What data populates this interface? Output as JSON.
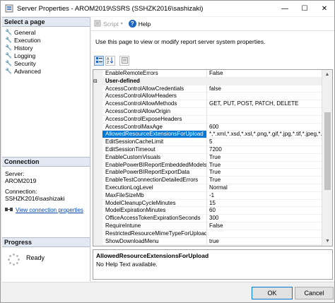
{
  "window": {
    "title": "Server Properties - AROM2019\\SSRS (SSHZK2016\\sashizaki)"
  },
  "left": {
    "select_page_header": "Select a page",
    "pages": [
      "General",
      "Execution",
      "History",
      "Logging",
      "Security",
      "Advanced"
    ],
    "connection_header": "Connection",
    "server_label": "Server:",
    "server_value": "AROM2019",
    "connection_label": "Connection:",
    "connection_value": "SSHZK2016\\sashizaki",
    "view_link": "View connection properties",
    "progress_header": "Progress",
    "progress_status": "Ready"
  },
  "toolbar": {
    "script_label": "Script",
    "help_label": "Help"
  },
  "description": "Use this page to view or modify report server system properties.",
  "grid": {
    "rows": [
      {
        "name": "EnableRemoteErrors",
        "value": "False"
      },
      {
        "name": "User-defined",
        "value": "",
        "category": true
      },
      {
        "name": "AccessControlAllowCredentials",
        "value": "false"
      },
      {
        "name": "AccessControlAllowHeaders",
        "value": ""
      },
      {
        "name": "AccessControlAllowMethods",
        "value": "GET, PUT, POST, PATCH, DELETE"
      },
      {
        "name": "AccessControlAllowOrigin",
        "value": ""
      },
      {
        "name": "AccessControlExposeHeaders",
        "value": ""
      },
      {
        "name": "AccessControlMaxAge",
        "value": "600"
      },
      {
        "name": "AllowedResourceExtensionsForUpload",
        "value": "*,*.xml,*.xsd,*.xsl,*.png,*.gif,*.jpg,*.tif,*.jpeg,*.tiff,*.",
        "selected": true
      },
      {
        "name": "EditSessionCacheLimit",
        "value": "5"
      },
      {
        "name": "EditSessionTimeout",
        "value": "7200"
      },
      {
        "name": "EnableCustomVisuals",
        "value": "True"
      },
      {
        "name": "EnablePowerBIReportEmbeddedModels",
        "value": "True"
      },
      {
        "name": "EnablePowerBIReportExportData",
        "value": "True"
      },
      {
        "name": "EnableTestConnectionDetailedErrors",
        "value": "True"
      },
      {
        "name": "ExecutionLogLevel",
        "value": "Normal"
      },
      {
        "name": "MaxFileSizeMb",
        "value": "-1"
      },
      {
        "name": "ModelCleanupCycleMinutes",
        "value": "15"
      },
      {
        "name": "ModelExpirationMinutes",
        "value": "60"
      },
      {
        "name": "OfficeAccessTokenExpirationSeconds",
        "value": "300"
      },
      {
        "name": "RequireIntune",
        "value": "False"
      },
      {
        "name": "RestrictedResourceMimeTypeForUpload",
        "value": ""
      },
      {
        "name": "ShowDownloadMenu",
        "value": "true"
      }
    ]
  },
  "help_panel": {
    "title": "AllowedResourceExtensionsForUpload",
    "text": "No Help Text available."
  },
  "buttons": {
    "ok": "OK",
    "cancel": "Cancel"
  }
}
